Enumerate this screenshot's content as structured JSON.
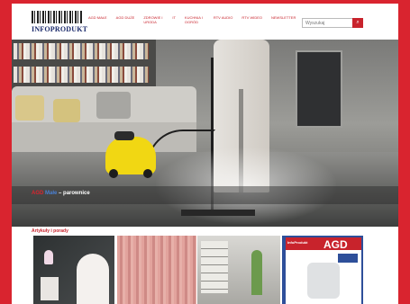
{
  "header": {
    "logo_text": "INFOPRODUKT",
    "nav": [
      {
        "label": "AGD MAŁE"
      },
      {
        "label": "AGD DUŻE"
      },
      {
        "label": "ZDROWIE I URODA"
      },
      {
        "label": "IT"
      },
      {
        "label": "KUCHNIA I OGRÓD"
      },
      {
        "label": "RTV AUDIO"
      },
      {
        "label": "RTV WIDEO"
      },
      {
        "label": "NEWSLETTER"
      }
    ],
    "search": {
      "placeholder": "Wyszukaj",
      "button_label": "⌕"
    }
  },
  "hero": {
    "caption_a": "AGD",
    "caption_b": "Małe",
    "caption_c": "– parownice"
  },
  "section": {
    "title": "Artykuły i porady"
  },
  "cards": {
    "magazine_brand": "InfoProdukt",
    "magazine_title": "AGD"
  },
  "colors": {
    "brand_red": "#d9242f",
    "accent_blue": "#2e4f9a"
  }
}
